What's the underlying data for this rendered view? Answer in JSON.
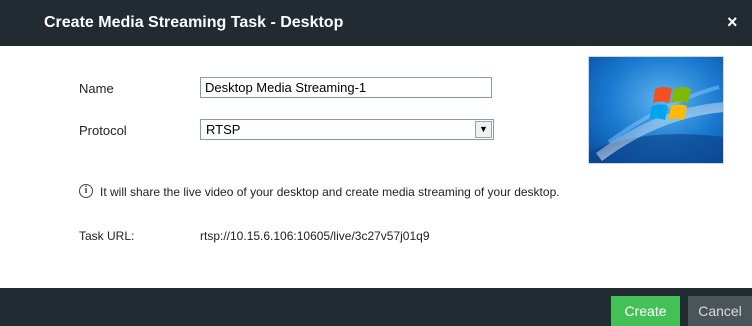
{
  "dialog": {
    "title": "Create Media Streaming Task - Desktop",
    "close_glyph": "×"
  },
  "form": {
    "name_label": "Name",
    "name_value": "Desktop Media Streaming-1",
    "protocol_label": "Protocol",
    "protocol_value": "RTSP",
    "info_text": "It will share the live video of your desktop and create media streaming of your desktop.",
    "task_url_label": "Task URL:",
    "task_url_value": "rtsp://10.15.6.106:10605/live/3c27v57j01q9"
  },
  "buttons": {
    "create_label": "Create",
    "cancel_label": "Cancel"
  },
  "icons": {
    "info": "info-icon",
    "dropdown": "chevron-down-icon",
    "close": "close-icon"
  },
  "colors": {
    "header_bg": "#212b31",
    "create_bg": "#43c157",
    "cancel_bg": "#4b5459"
  }
}
